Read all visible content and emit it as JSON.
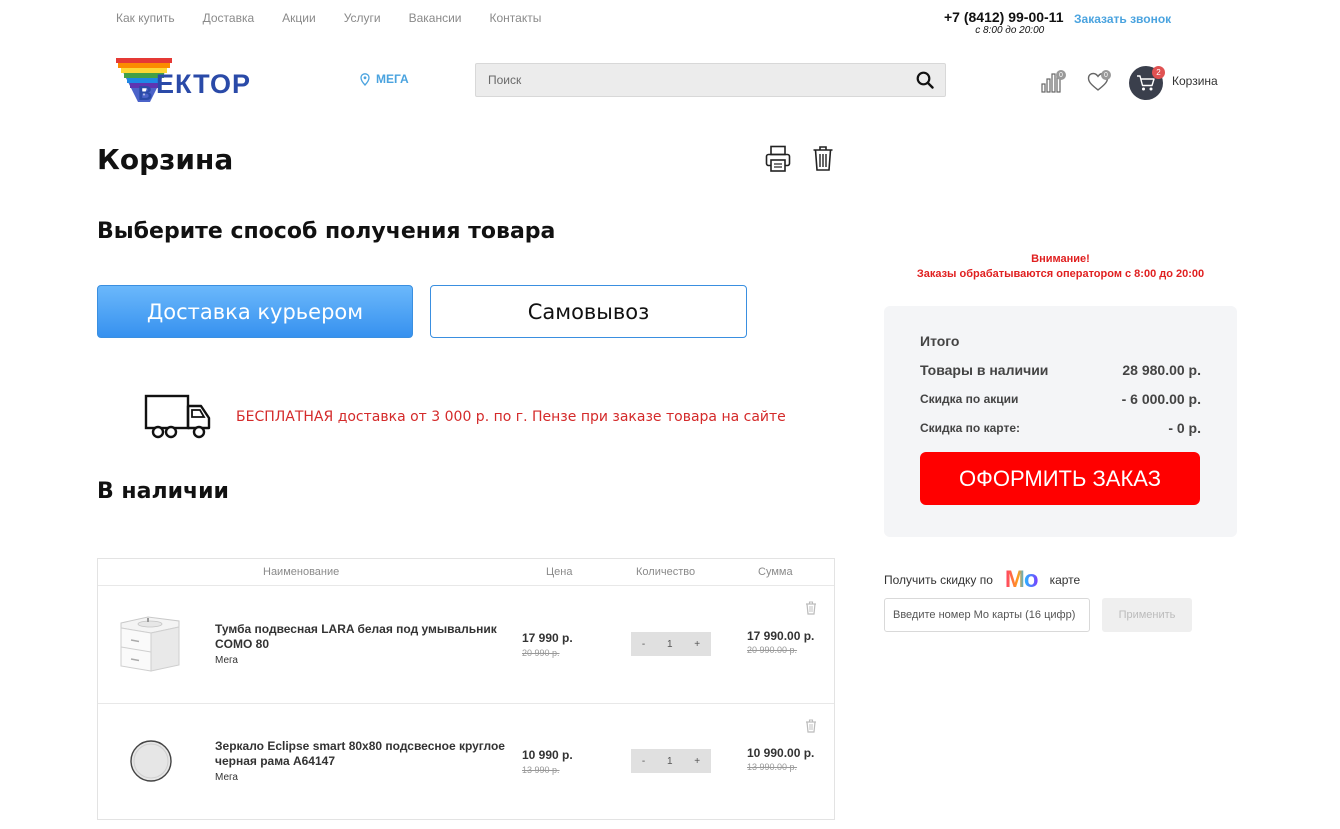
{
  "top_nav": [
    "Как купить",
    "Доставка",
    "Акции",
    "Услуги",
    "Вакансии",
    "Контакты"
  ],
  "header": {
    "phone": "+7 (8412) 99-00-11",
    "hours": "с 8:00 до 20:00",
    "callback": "Заказать звонок",
    "logo_text": "ЕКТОР",
    "city": "МЕГА",
    "search_placeholder": "Поиск",
    "compare_count": "0",
    "favorites_count": "0",
    "cart_count": "2",
    "cart_label": "Корзина"
  },
  "page": {
    "title": "Корзина",
    "delivery_heading": "Выберите способ получения товара",
    "courier_button": "Доставка курьером",
    "pickup_button": "Самовывоз",
    "free_delivery_text": "БЕСПЛАТНАЯ доставка от 3 000 р. по г. Пензе при заказе товара на сайте",
    "in_stock_heading": "В наличии"
  },
  "table": {
    "columns": [
      "Наименование",
      "Цена",
      "Количество",
      "Сумма"
    ],
    "rows": [
      {
        "name": "Тумба подвесная LARA белая под умывальник COMO 80",
        "store": "Мега",
        "price": "17 990 р.",
        "old_price": "20 990 р.",
        "qty_minus": "-",
        "qty": "1",
        "qty_plus": "+",
        "sum": "17 990.00 р.",
        "old_sum": "20 990.00 р."
      },
      {
        "name": "Зеркало Eclipse smart 80x80 подсвесное круглое черная рама A64147",
        "store": "Мега",
        "price": "10 990 р.",
        "old_price": "13 990 р.",
        "qty_minus": "-",
        "qty": "1",
        "qty_plus": "+",
        "sum": "10 990.00 р.",
        "old_sum": "13 990.00 р."
      }
    ]
  },
  "sidebar": {
    "warning_title": "Внимание!",
    "warning_text": "Заказы обрабатываются оператором с 8:00 до 20:00",
    "summary_title": "Итого",
    "items_label": "Товары в наличии",
    "items_value": "28 980.00 р.",
    "promo_label": "Скидка по акции",
    "promo_value": "- 6 000.00 р.",
    "card_label": "Скидка по карте:",
    "card_value": "- 0 р.",
    "checkout_button": "ОФОРМИТЬ ЗАКАЗ",
    "discount_prefix": "Получить скидку по",
    "discount_logo": "Mo",
    "discount_suffix": "карте",
    "card_placeholder": "Введите номер Мо карты (16 цифр)",
    "apply_button": "Применить"
  },
  "colors": {
    "accent_blue": "#4aa3df",
    "checkout_red": "#ff0000",
    "warning_red": "#e02020",
    "courier_gradient_top": "#6bb8fb",
    "courier_gradient_bottom": "#3691ef"
  }
}
